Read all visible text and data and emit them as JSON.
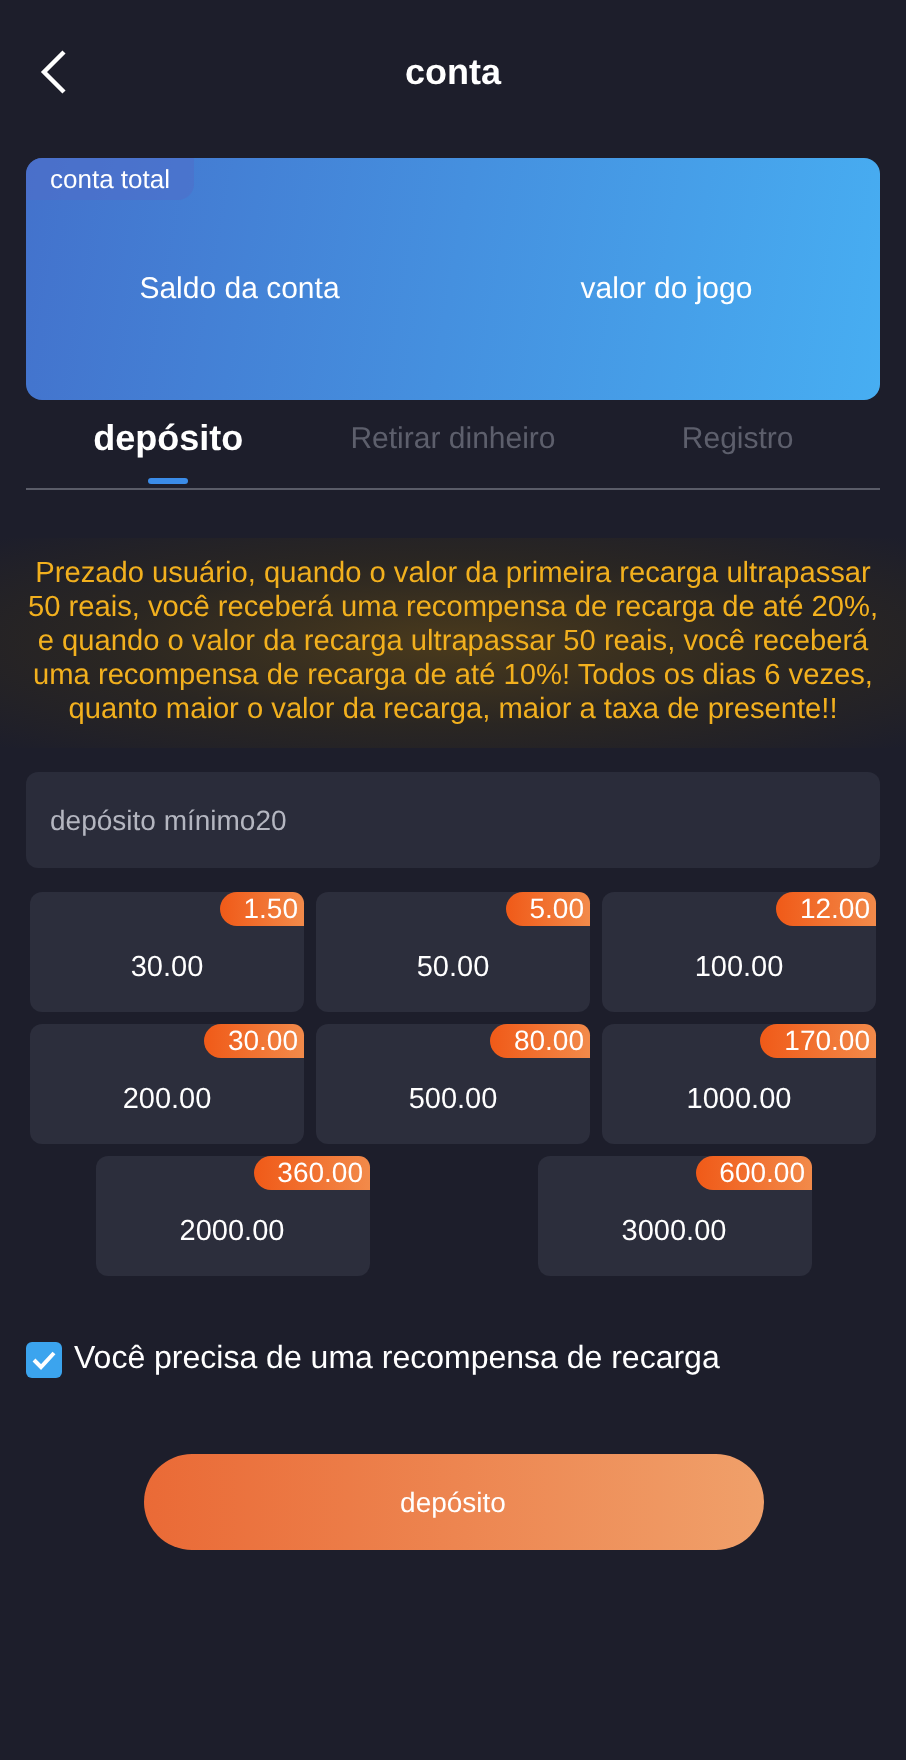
{
  "header": {
    "title": "conta"
  },
  "account_card": {
    "badge": "conta total",
    "fields": [
      "Saldo da conta",
      "valor do jogo"
    ]
  },
  "tabs": [
    {
      "label": "depósito",
      "selected": true
    },
    {
      "label": "Retirar dinheiro",
      "selected": false
    },
    {
      "label": "Registro",
      "selected": false
    }
  ],
  "notice": "Prezado usuário, quando o valor da primeira recarga ultrapassar 50 reais, você receberá uma recompensa de recarga de até 20%, e quando o valor da recarga ultrapassar 50 reais, você receberá uma recompensa de recarga de até 10%! Todos os dias 6 vezes, quanto maior o valor da recarga, maior a taxa de presente!!",
  "amount_field": {
    "placeholder": "depósito mínimo20"
  },
  "amounts": [
    {
      "amount": "30.00",
      "bonus": "1.50",
      "selected": false
    },
    {
      "amount": "50.00",
      "bonus": "5.00",
      "selected": false
    },
    {
      "amount": "100.00",
      "bonus": "12.00",
      "selected": false
    },
    {
      "amount": "200.00",
      "bonus": "30.00",
      "selected": false
    },
    {
      "amount": "500.00",
      "bonus": "80.00",
      "selected": false
    },
    {
      "amount": "1000.00",
      "bonus": "170.00",
      "selected": false
    },
    {
      "amount": "2000.00",
      "bonus": "360.00",
      "selected": false
    },
    {
      "amount": "3000.00",
      "bonus": "600.00",
      "selected": false
    }
  ],
  "reward_option": {
    "label": "Você precisa de uma recompensa de recarga",
    "checked": true
  },
  "submit_button": "depósito"
}
